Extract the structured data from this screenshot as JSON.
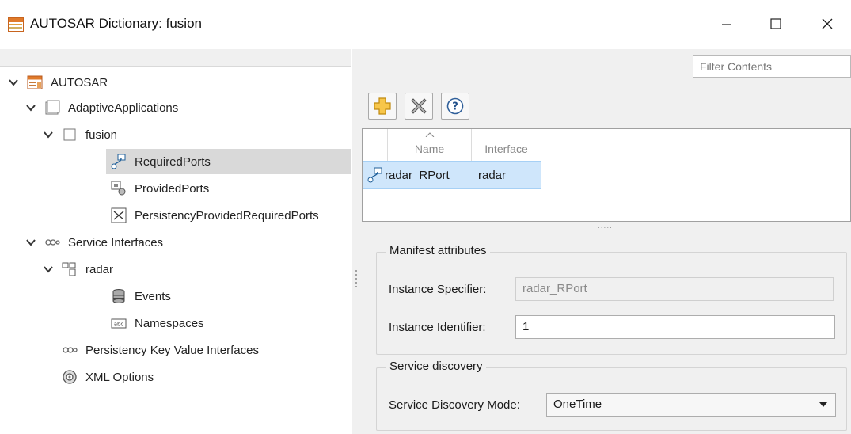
{
  "window": {
    "title": "AUTOSAR Dictionary: fusion",
    "minimize_icon": "minimize-icon",
    "maximize_icon": "maximize-icon",
    "close_icon": "close-icon"
  },
  "tree": {
    "items": [
      {
        "label": "AUTOSAR",
        "icon": "autosar-package-icon",
        "expanded": true
      },
      {
        "label": "AdaptiveApplications",
        "icon": "folder-icon",
        "expanded": true
      },
      {
        "label": "fusion",
        "icon": "component-icon",
        "expanded": true
      },
      {
        "label": "RequiredPorts",
        "icon": "required-port-icon",
        "selected": true
      },
      {
        "label": "ProvidedPorts",
        "icon": "provided-port-icon"
      },
      {
        "label": "PersistencyProvidedRequiredPorts",
        "icon": "persistency-port-icon"
      },
      {
        "label": "Service Interfaces",
        "icon": "interfaces-icon",
        "expanded": true
      },
      {
        "label": "radar",
        "icon": "service-interface-icon",
        "expanded": true
      },
      {
        "label": "Events",
        "icon": "events-icon"
      },
      {
        "label": "Namespaces",
        "icon": "namespaces-icon"
      },
      {
        "label": "Persistency Key Value Interfaces",
        "icon": "interfaces-icon"
      },
      {
        "label": "XML Options",
        "icon": "gear-icon"
      }
    ]
  },
  "right": {
    "filter_placeholder": "Filter Contents",
    "toolbar": {
      "add_icon": "add-icon",
      "delete_icon": "delete-icon",
      "help_icon": "help-icon"
    },
    "table": {
      "columns": [
        "Name",
        "Interface"
      ],
      "rows": [
        {
          "name": "radar_RPort",
          "interface": "radar",
          "icon": "required-port-icon"
        }
      ]
    },
    "manifest": {
      "title": "Manifest attributes",
      "instance_specifier_label": "Instance Specifier:",
      "instance_specifier_value": "radar_RPort",
      "instance_identifier_label": "Instance Identifier:",
      "instance_identifier_value": "1"
    },
    "service_discovery": {
      "title": "Service discovery",
      "mode_label": "Service Discovery Mode:",
      "mode_value": "OneTime"
    }
  },
  "colors": {
    "selection": "#cfe6fb",
    "tree_selection": "#d9d9d9",
    "pane_bg": "#f0f0f0"
  }
}
